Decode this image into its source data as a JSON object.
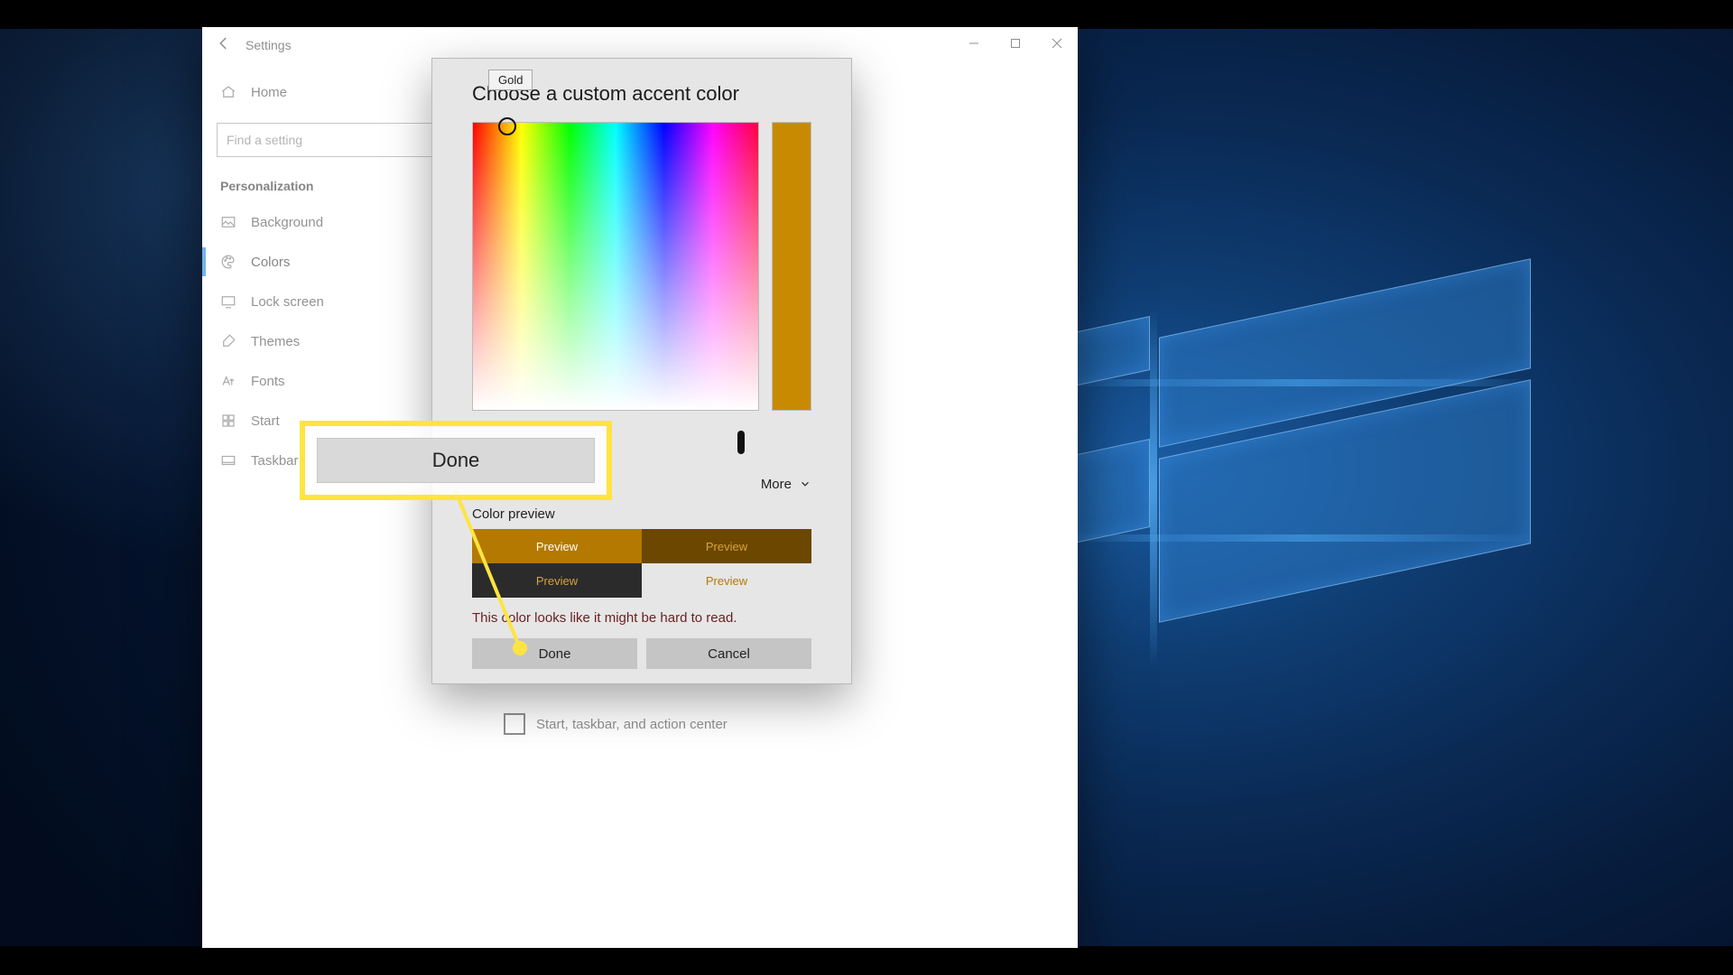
{
  "window": {
    "title": "Settings"
  },
  "sidebar": {
    "home": "Home",
    "search_placeholder": "Find a setting",
    "category": "Personalization",
    "items": [
      {
        "label": "Background"
      },
      {
        "label": "Colors"
      },
      {
        "label": "Lock screen"
      },
      {
        "label": "Themes"
      },
      {
        "label": "Fonts"
      },
      {
        "label": "Start"
      },
      {
        "label": "Taskbar"
      }
    ]
  },
  "content": {
    "checkbox_label": "Start, taskbar, and action center"
  },
  "picker": {
    "tooltip": "Gold",
    "title": "Choose a custom accent color",
    "more": "More",
    "preview_label": "Color preview",
    "preview_text": "Preview",
    "warning": "This color looks like it might be hard to read.",
    "done": "Done",
    "cancel": "Cancel",
    "accent_hex": "#c88a00"
  },
  "callout": {
    "label": "Done"
  }
}
